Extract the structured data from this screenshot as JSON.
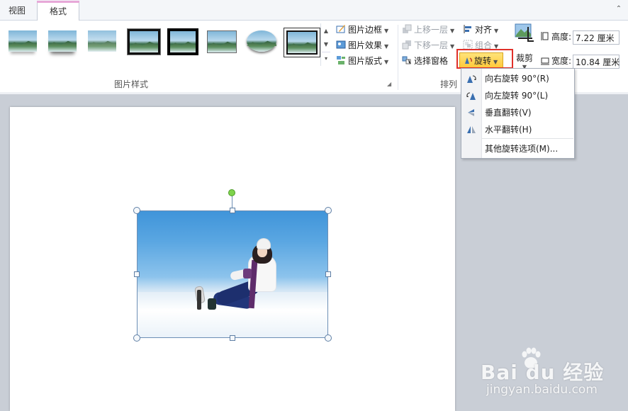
{
  "tabs": [
    {
      "label": "视图"
    },
    {
      "label": "格式"
    }
  ],
  "ribbon": {
    "picture_styles_group": "图片样式",
    "picture_border": "图片边框",
    "picture_effects": "图片效果",
    "picture_layout": "图片版式",
    "arrange_group": "排列",
    "bring_forward": "上移一层",
    "send_backward": "下移一层",
    "selection_pane": "选择窗格",
    "align": "对齐",
    "group": "组合",
    "rotate": "旋转",
    "crop": "裁剪",
    "height_label": "高度:",
    "height_value": "7.22 厘米",
    "width_label": "宽度:",
    "width_value": "10.84 厘米"
  },
  "rotate_menu": {
    "items": [
      {
        "label": "向右旋转 90°(R)",
        "icon": "rotate-right-90-icon"
      },
      {
        "label": "向左旋转 90°(L)",
        "icon": "rotate-left-90-icon"
      },
      {
        "label": "垂直翻转(V)",
        "icon": "flip-vertical-icon"
      },
      {
        "label": "水平翻转(H)",
        "icon": "flip-horizontal-icon"
      },
      {
        "label": "其他旋转选项(M)...",
        "icon": ""
      }
    ]
  },
  "watermark": {
    "brand": "Bai du 经验",
    "url": "jingyan.baidu.com"
  },
  "colors": {
    "rotate_button": "#ffc93b",
    "highlight_box": "#e0302a",
    "rotation_handle": "#7ed34c",
    "format_tab_accent": "#e7a8d8"
  }
}
